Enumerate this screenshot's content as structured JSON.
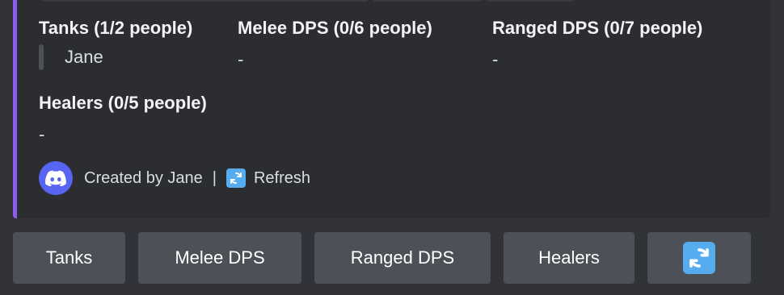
{
  "fields": {
    "tanks": {
      "name": "Tanks (1/2 people)",
      "value": "Jane"
    },
    "melee": {
      "name": "Melee DPS (0/6 people)",
      "value": "-"
    },
    "ranged": {
      "name": "Ranged DPS (0/7 people)",
      "value": "-"
    },
    "healers": {
      "name": "Healers (0/5 people)",
      "value": "-"
    }
  },
  "footer": {
    "created_by": "Created by Jane",
    "separator": "|",
    "refresh_label": "Refresh",
    "icon": "discord-icon",
    "refresh_icon": "refresh-emoji-icon"
  },
  "buttons": {
    "tanks": "Tanks",
    "melee": "Melee DPS",
    "ranged": "Ranged DPS",
    "healers": "Healers",
    "refresh_icon": "refresh-emoji-icon"
  },
  "colors": {
    "embed_accent": "#8c5cf0",
    "background": "#313338",
    "embed_background": "#2b2d31",
    "button_background": "#4e5058",
    "discord_blurple": "#5865f2",
    "emoji_blue": "#55acee"
  }
}
